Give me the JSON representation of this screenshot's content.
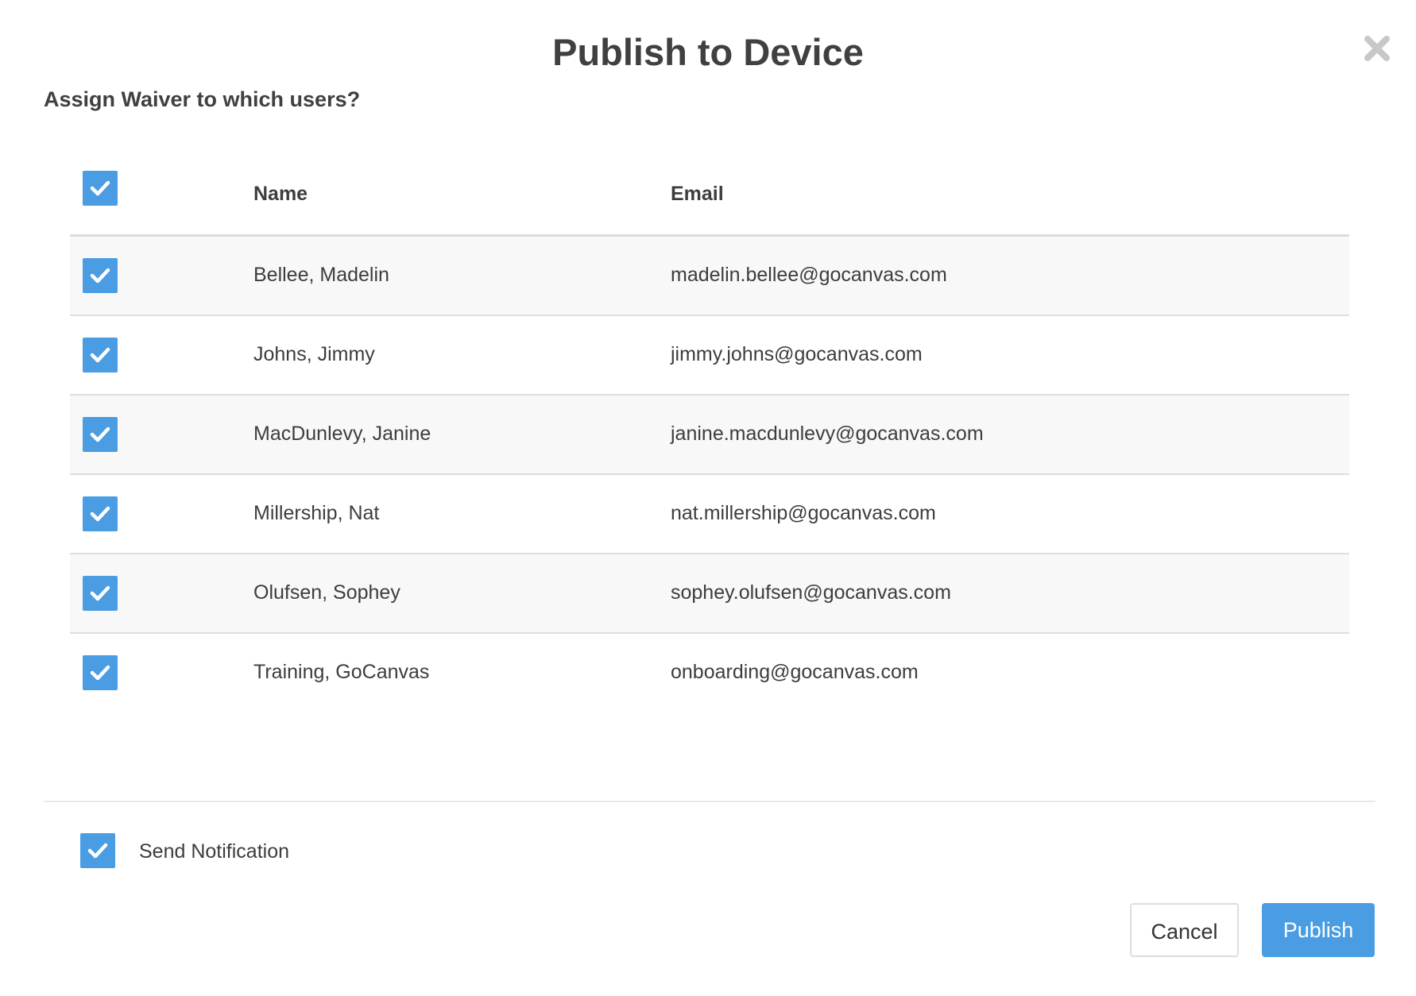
{
  "dialog": {
    "title": "Publish to Device",
    "subtitle": "Assign Waiver to which users?"
  },
  "table": {
    "headers": {
      "name": "Name",
      "email": "Email"
    },
    "select_all_checked": true,
    "rows": [
      {
        "name": "Bellee, Madelin",
        "email": "madelin.bellee@gocanvas.com",
        "checked": true
      },
      {
        "name": "Johns, Jimmy",
        "email": "jimmy.johns@gocanvas.com",
        "checked": true
      },
      {
        "name": "MacDunlevy, Janine",
        "email": "janine.macdunlevy@gocanvas.com",
        "checked": true
      },
      {
        "name": "Millership, Nat",
        "email": "nat.millership@gocanvas.com",
        "checked": true
      },
      {
        "name": "Olufsen, Sophey",
        "email": "sophey.olufsen@gocanvas.com",
        "checked": true
      },
      {
        "name": "Training, GoCanvas",
        "email": "onboarding@gocanvas.com",
        "checked": true
      }
    ]
  },
  "notification": {
    "label": "Send Notification",
    "checked": true
  },
  "actions": {
    "cancel_label": "Cancel",
    "publish_label": "Publish"
  },
  "colors": {
    "accent": "#4a9de3",
    "row_alt": "#f8f8f8",
    "border": "#dddddd",
    "close_icon": "#c8c8c8"
  },
  "icons": {
    "close": "close-icon",
    "check": "checkmark-icon"
  }
}
